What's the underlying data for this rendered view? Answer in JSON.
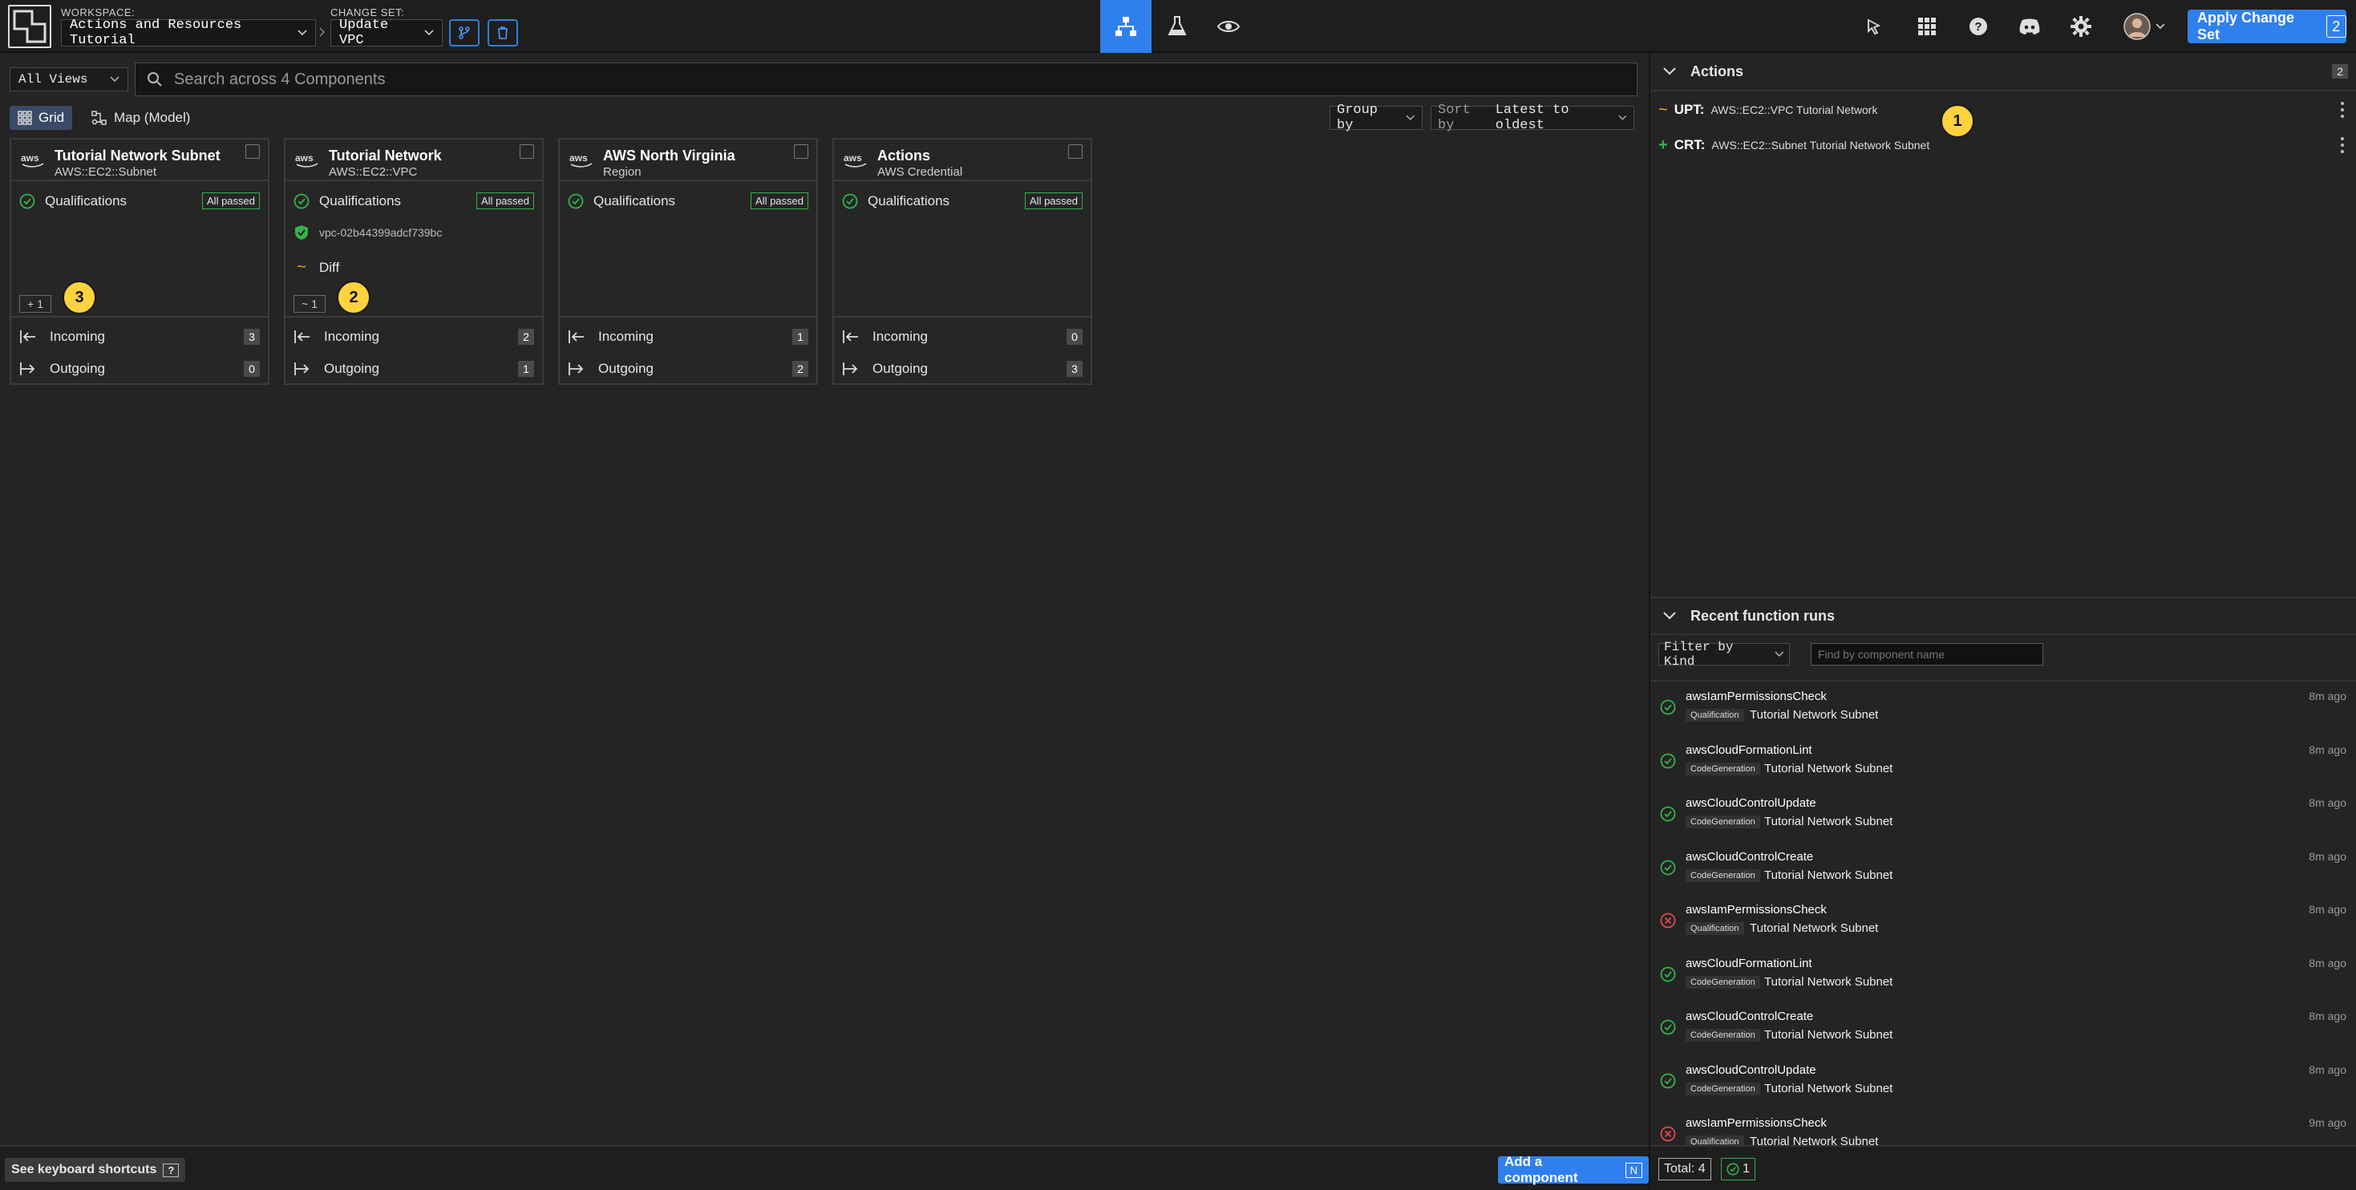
{
  "header": {
    "workspace_label": "WORKSPACE:",
    "workspace_value": "Actions and Resources Tutorial",
    "changeset_label": "CHANGE SET:",
    "changeset_value": "Update VPC",
    "apply_label": "Apply Change Set",
    "apply_count": "2",
    "accent": "#2f80ed"
  },
  "toolbar": {
    "views": "All Views",
    "search_placeholder": "Search across 4 Components",
    "grid_label": "Grid",
    "map_label": "Map (Model)",
    "group_by": "Group by",
    "sort_prefix": "Sort by",
    "sort_value": "Latest to oldest"
  },
  "cards": [
    {
      "title": "Tutorial Network Subnet",
      "subtitle": "AWS::EC2::Subnet",
      "qualifications": "Qualifications",
      "status": "All passed",
      "resource_id": "",
      "diff": "",
      "diff_count": "1",
      "incoming": "Incoming",
      "incoming_count": "3",
      "outgoing": "Outgoing",
      "outgoing_count": "0",
      "marker": "3"
    },
    {
      "title": "Tutorial Network",
      "subtitle": "AWS::EC2::VPC",
      "qualifications": "Qualifications",
      "status": "All passed",
      "resource_id": "vpc-02b44399adcf739bc",
      "diff": "Diff",
      "diff_count": "1",
      "incoming": "Incoming",
      "incoming_count": "2",
      "outgoing": "Outgoing",
      "outgoing_count": "1",
      "marker": "2"
    },
    {
      "title": "AWS North Virginia",
      "subtitle": "Region",
      "qualifications": "Qualifications",
      "status": "All passed",
      "incoming": "Incoming",
      "incoming_count": "1",
      "outgoing": "Outgoing",
      "outgoing_count": "2"
    },
    {
      "title": "Actions",
      "subtitle": "AWS Credential",
      "qualifications": "Qualifications",
      "status": "All passed",
      "incoming": "Incoming",
      "incoming_count": "0",
      "outgoing": "Outgoing",
      "outgoing_count": "3"
    }
  ],
  "bottombar": {
    "shortcuts_label": "See keyboard shortcuts",
    "shortcuts_key": "?",
    "add_label": "Add a component",
    "add_key": "N"
  },
  "actions_panel": {
    "title": "Actions",
    "count": "2",
    "marker": "1",
    "items": [
      {
        "kind": "UPT:",
        "desc": "AWS::EC2::VPC Tutorial Network"
      },
      {
        "kind": "CRT:",
        "desc": "AWS::EC2::Subnet Tutorial Network Subnet"
      }
    ]
  },
  "recent_runs": {
    "title": "Recent function runs",
    "filter_kind": "Filter by Kind",
    "filter_placeholder": "Find by component name",
    "items": [
      {
        "fn": "awsIamPermissionsCheck",
        "kind": "Qualification",
        "component": "Tutorial Network Subnet",
        "ago": "8m ago",
        "ok": true
      },
      {
        "fn": "awsCloudFormationLint",
        "kind": "CodeGeneration",
        "component": "Tutorial Network Subnet",
        "ago": "8m ago",
        "ok": true
      },
      {
        "fn": "awsCloudControlUpdate",
        "kind": "CodeGeneration",
        "component": "Tutorial Network Subnet",
        "ago": "8m ago",
        "ok": true
      },
      {
        "fn": "awsCloudControlCreate",
        "kind": "CodeGeneration",
        "component": "Tutorial Network Subnet",
        "ago": "8m ago",
        "ok": true
      },
      {
        "fn": "awsIamPermissionsCheck",
        "kind": "Qualification",
        "component": "Tutorial Network Subnet",
        "ago": "8m ago",
        "ok": false
      },
      {
        "fn": "awsCloudFormationLint",
        "kind": "CodeGeneration",
        "component": "Tutorial Network Subnet",
        "ago": "8m ago",
        "ok": true
      },
      {
        "fn": "awsCloudControlCreate",
        "kind": "CodeGeneration",
        "component": "Tutorial Network Subnet",
        "ago": "8m ago",
        "ok": true
      },
      {
        "fn": "awsCloudControlUpdate",
        "kind": "CodeGeneration",
        "component": "Tutorial Network Subnet",
        "ago": "8m ago",
        "ok": true
      },
      {
        "fn": "awsIamPermissionsCheck",
        "kind": "Qualification",
        "component": "Tutorial Network Subnet",
        "ago": "9m ago",
        "ok": false
      }
    ],
    "total": "Total: 4",
    "ok_count": "1"
  },
  "colors": {
    "success": "#33b34a",
    "error": "#e5484d",
    "marker": "#ffd23f",
    "update": "#f5a524",
    "create": "#33b34a"
  }
}
